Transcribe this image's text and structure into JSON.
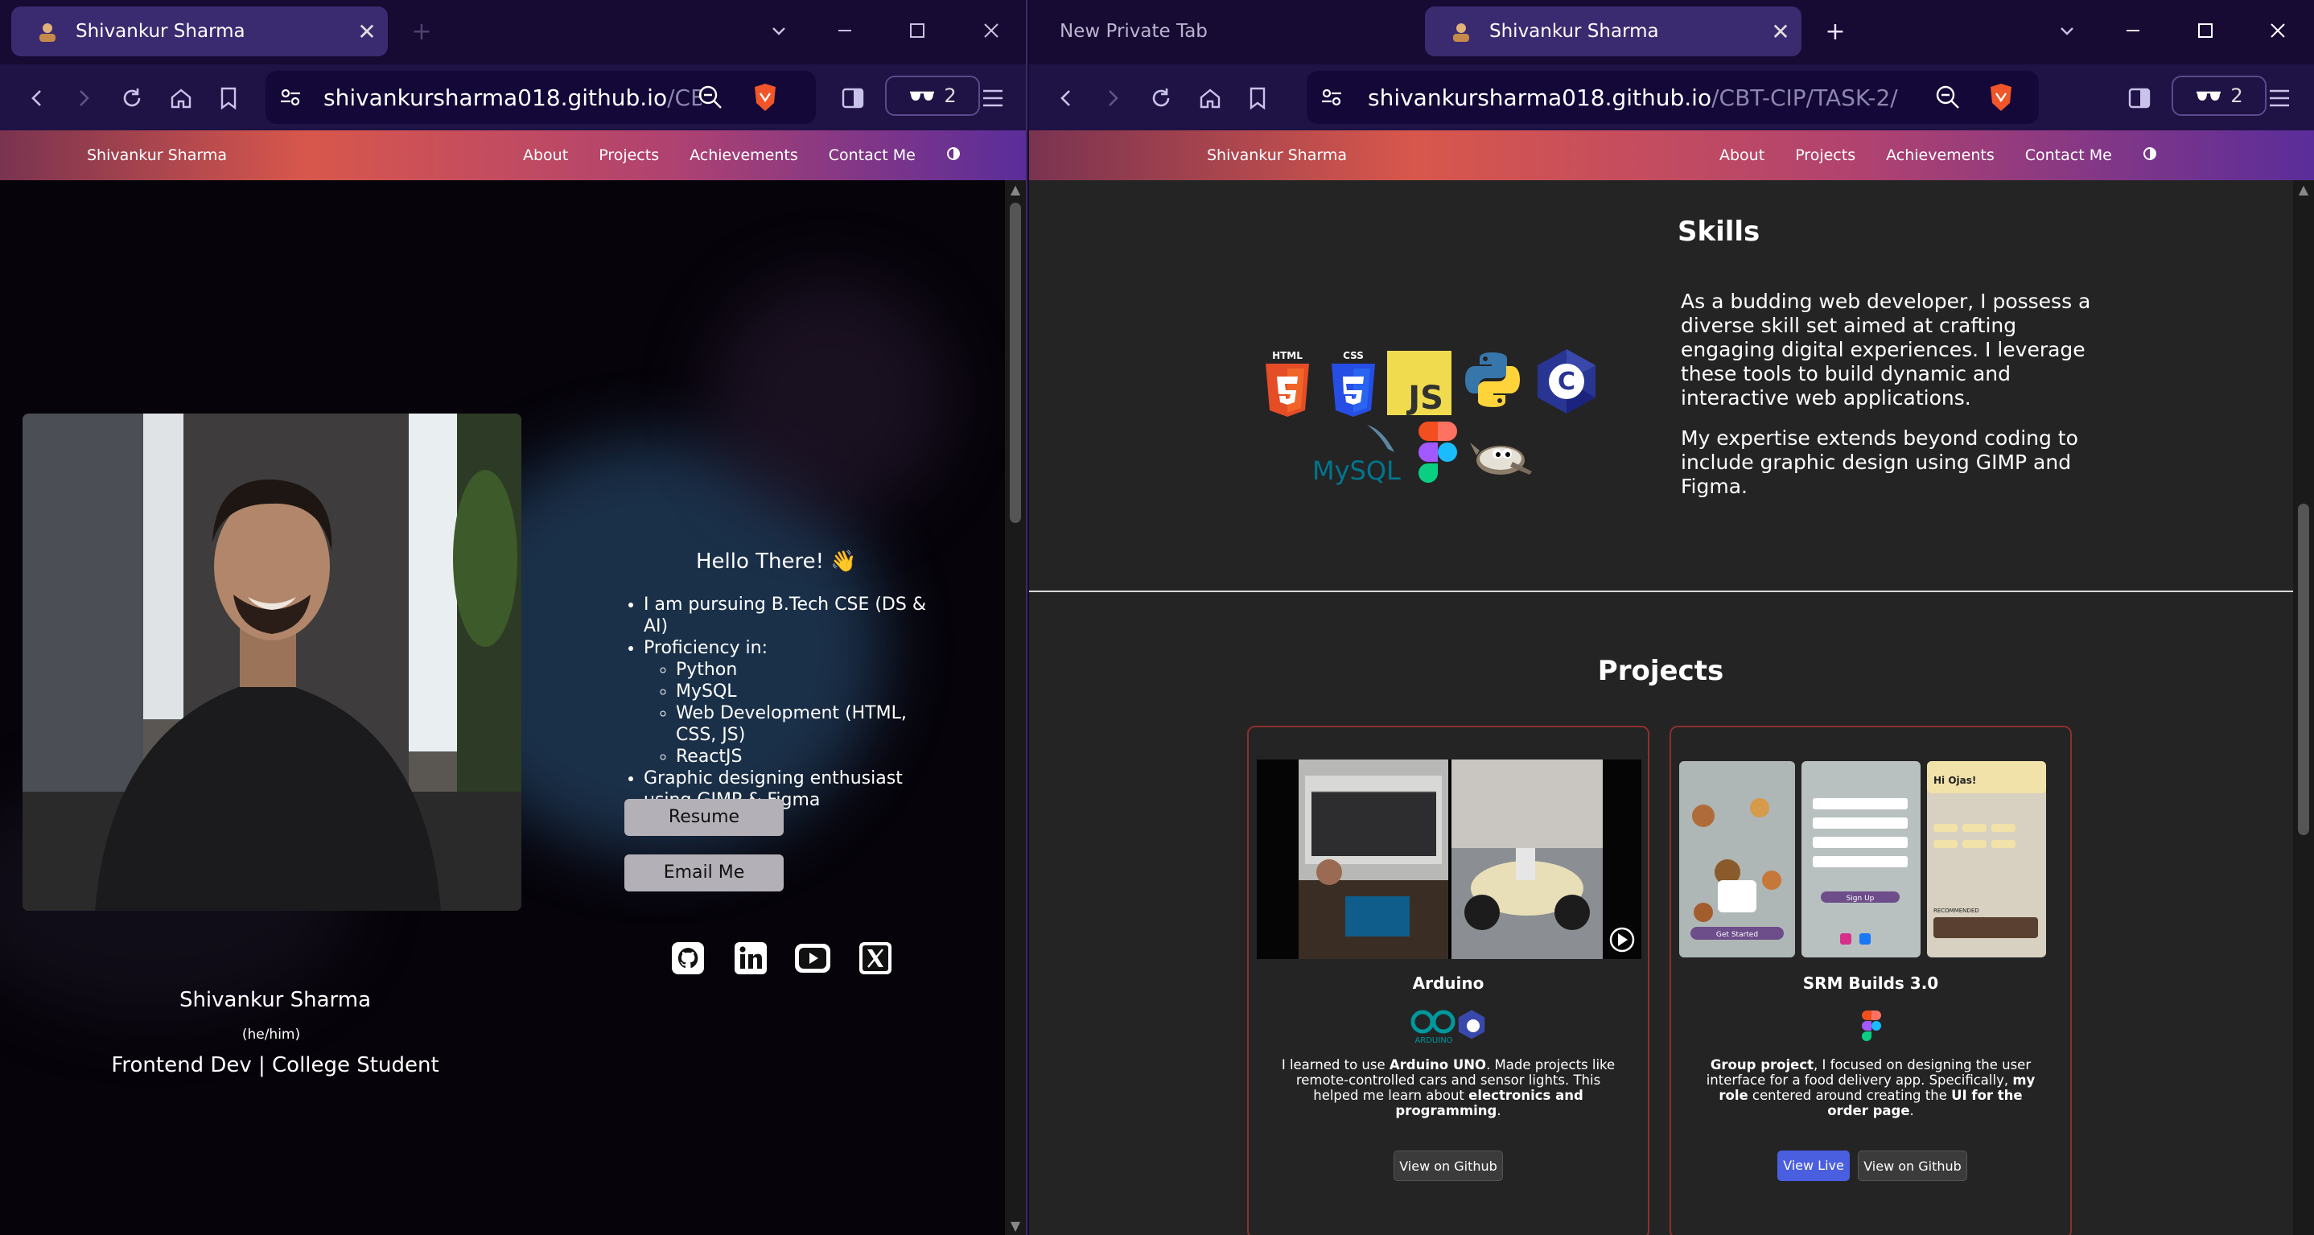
{
  "left_window": {
    "tab_title": "Shivankur Sharma",
    "url_host": "shivankursharma018.github.io",
    "url_path": "/CB...",
    "shield_count": "2",
    "site": {
      "brand": "Shivankur Sharma",
      "nav": [
        "About",
        "Projects",
        "Achievements",
        "Contact Me"
      ],
      "greeting": "Hello There! 👋",
      "bullets": {
        "b1": "I am pursuing B.Tech CSE (DS & AI)",
        "b2": "Proficiency in:",
        "sub": [
          "Python",
          "MySQL",
          "Web Development (HTML, CSS, JS)",
          "ReactJS"
        ],
        "b3": "Graphic designing enthusiast using GIMP & Figma"
      },
      "resume_label": "Resume",
      "email_label": "Email Me",
      "name": "Shivankur Sharma",
      "pronouns": "(he/him)",
      "role": "Frontend Dev | College Student"
    }
  },
  "right_window": {
    "tab_inactive_title": "New Private Tab",
    "tab_title": "Shivankur Sharma",
    "url_host": "shivankursharma018.github.io",
    "url_path": "/CBT-CIP/TASK-2/",
    "shield_count": "2",
    "site": {
      "brand": "Shivankur Sharma",
      "nav": [
        "About",
        "Projects",
        "Achievements",
        "Contact Me"
      ],
      "skills_heading": "Skills",
      "skills_p1": "As a budding web developer, I possess a diverse skill set aimed at crafting engaging digital experiences. I leverage these tools to build dynamic and interactive web applications.",
      "skills_p2": "My expertise extends beyond coding to include graphic design using GIMP and Figma.",
      "skill_labels": {
        "html": "HTML",
        "css": "CSS",
        "js": "JS",
        "c": "C",
        "mysql": "MySQL"
      },
      "projects_heading": "Projects",
      "project1": {
        "title": "Arduino",
        "logo_text": "ARDUINO",
        "desc_parts": [
          "I learned to use ",
          "Arduino UNO",
          ". Made projects like remote-controlled cars and sensor lights. This helped me learn about ",
          "electronics and programming",
          "."
        ],
        "github_label": "View on Github"
      },
      "project2": {
        "title": "SRM Builds 3.0",
        "desc_parts": [
          "Group project",
          ", I focused on designing the user interface for a food delivery app. Specifically, ",
          "my role",
          " centered around creating the ",
          "UI for the order page",
          "."
        ],
        "live_label": "View Live",
        "github_label": "View on Github",
        "screen1_caption": "Get Started",
        "screen2_caption": "Sign Up",
        "screen3_caption": "Hi Ojas!",
        "screen3_sub": "RECOMMENDED"
      }
    }
  },
  "colors": {
    "tab_bg": "#170a33",
    "toolbar_bg": "#1f1244",
    "accent_blue": "#4a5ee0",
    "card_border": "#8e2f2f"
  }
}
